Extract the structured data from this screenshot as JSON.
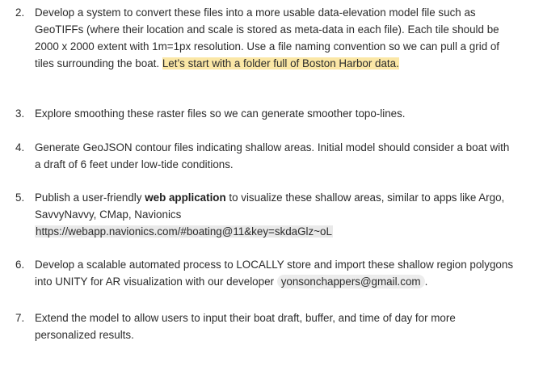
{
  "items": [
    {
      "number": "2.",
      "text": "Develop a system to convert these files into a more usable data-elevation model file such as GeoTIFFs (where their location and scale is stored as meta-data in each file). Each tile should be 2000 x 2000 extent with 1m=1px resolution. Use a file naming convention so we can pull a grid of tiles surrounding the boat. ",
      "highlight": "Let’s start with a folder full of Boston Harbor data."
    },
    {
      "number": "3.",
      "text": "Explore smoothing these raster files so we can generate smoother topo-lines."
    },
    {
      "number": "4.",
      "text": "Generate GeoJSON contour files indicating shallow areas. Initial model should consider a boat with a draft of 6 feet under low-tide conditions."
    },
    {
      "number": "5.",
      "pre": "Publish a user-friendly ",
      "bold": "web application",
      "post": " to visualize these shallow areas, similar to apps like Argo, SavvyNavvy, CMap, Navionics",
      "url": "https://webapp.navionics.com/#boating@11&key=skdaGlz~oL"
    },
    {
      "number": "6.",
      "text": "Develop a scalable automated process to LOCALLY store and import these shallow region polygons into UNITY for AR visualization with our developer ",
      "email": "yonsonchappers@gmail.com",
      "tail": "."
    },
    {
      "number": "7.",
      "text": "Extend the model to allow users to input their boat draft, buffer, and time of day for more personalized results."
    }
  ]
}
